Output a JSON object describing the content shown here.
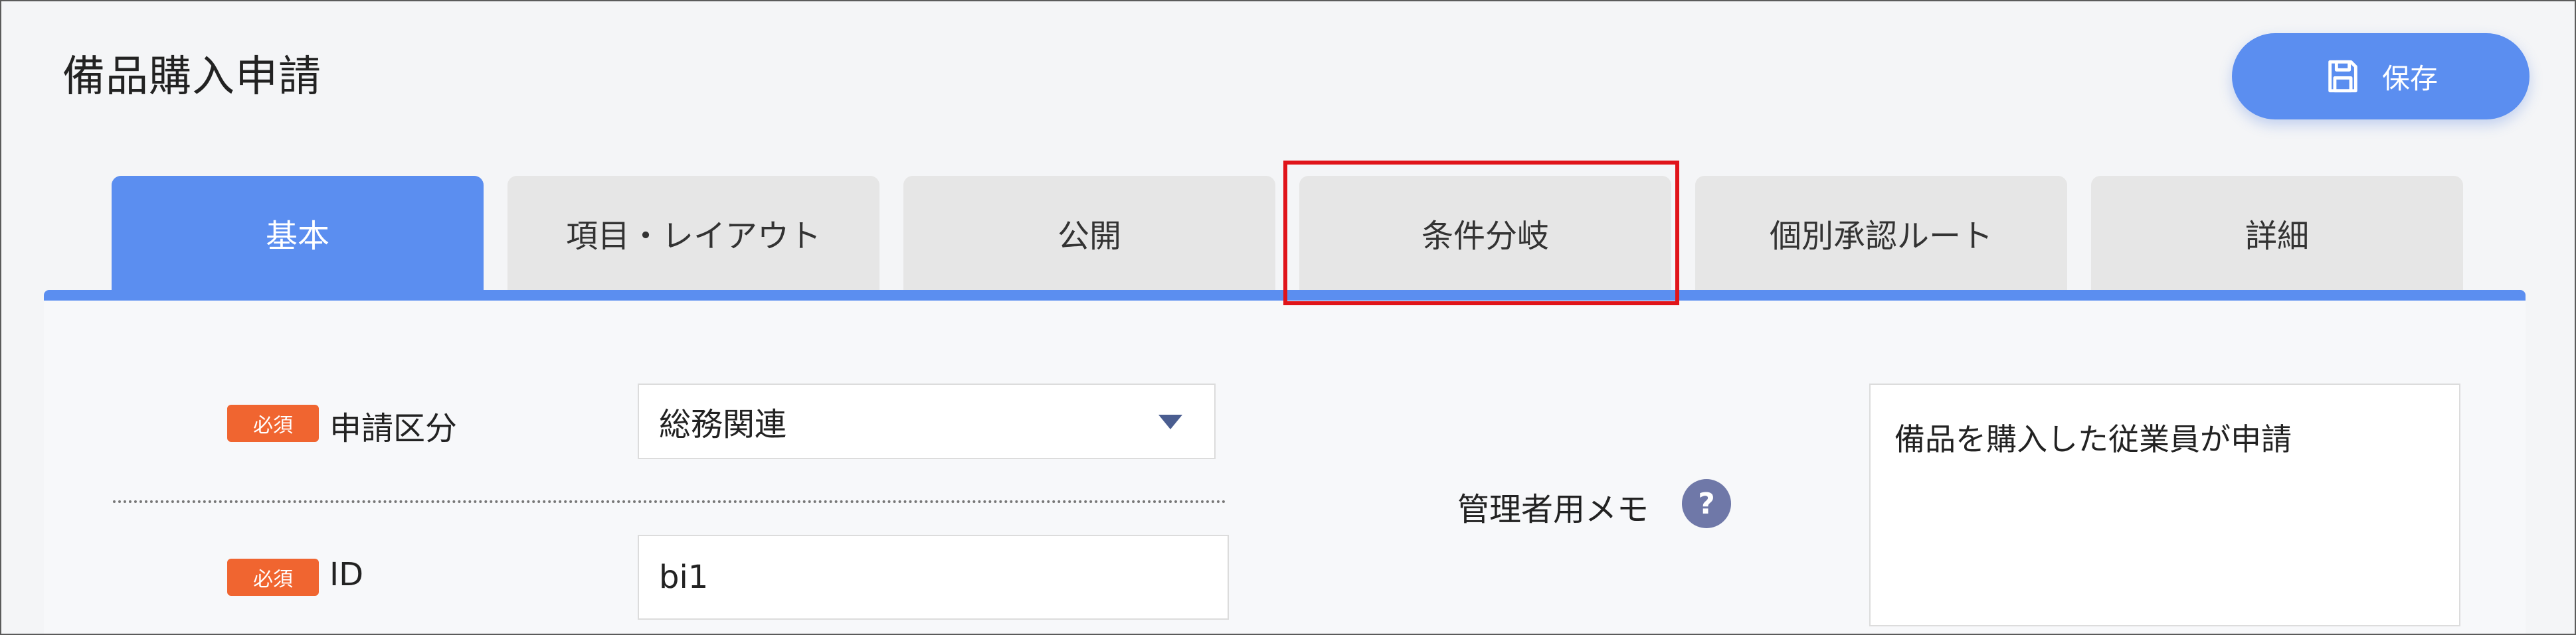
{
  "page": {
    "title": "備品購入申請"
  },
  "toolbar": {
    "save_label": "保存",
    "save_icon": "floppy-disk-icon",
    "accent_color": "#5b8ef0"
  },
  "tabs": [
    {
      "label": "基本",
      "active": true
    },
    {
      "label": "項目・レイアウト",
      "active": false
    },
    {
      "label": "公開",
      "active": false
    },
    {
      "label": "条件分岐",
      "active": false,
      "highlighted": true
    },
    {
      "label": "個別承認ルート",
      "active": false
    },
    {
      "label": "詳細",
      "active": false
    }
  ],
  "form": {
    "category": {
      "badge": "必須",
      "label": "申請区分",
      "value": "総務関連"
    },
    "id": {
      "badge": "必須",
      "label": "ID",
      "value": "bi1"
    },
    "admin_memo": {
      "label": "管理者用メモ",
      "help_icon": "?",
      "value": "備品を購入した従業員が申請"
    }
  },
  "colors": {
    "required_badge": "#f06530",
    "highlight_box": "#e0141a",
    "help_icon": "#6f78a8"
  }
}
